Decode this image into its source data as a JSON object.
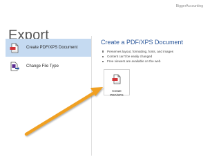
{
  "watermark": "BiggerAccounting",
  "page": {
    "title": "Export"
  },
  "nav": {
    "items": [
      {
        "label": "Create PDF/XPS Document",
        "icon": "pdf-document-icon",
        "selected": true
      },
      {
        "label": "Change File Type",
        "icon": "change-file-type-icon",
        "selected": false
      }
    ]
  },
  "detail": {
    "title": "Create a PDF/XPS Document",
    "bullets": [
      "Preserves layout, formatting, fonts, and images",
      "Content can't be easily changed",
      "Free viewers are available on the web"
    ],
    "button": {
      "label": "Create\nPDF/XPS",
      "icon": "pdf-document-icon"
    }
  },
  "colors": {
    "selected_background": "#c5daf1",
    "accent_title": "#2b579a",
    "annotation_arrow": "#f0a020",
    "pdf_badge": "#d13438"
  }
}
